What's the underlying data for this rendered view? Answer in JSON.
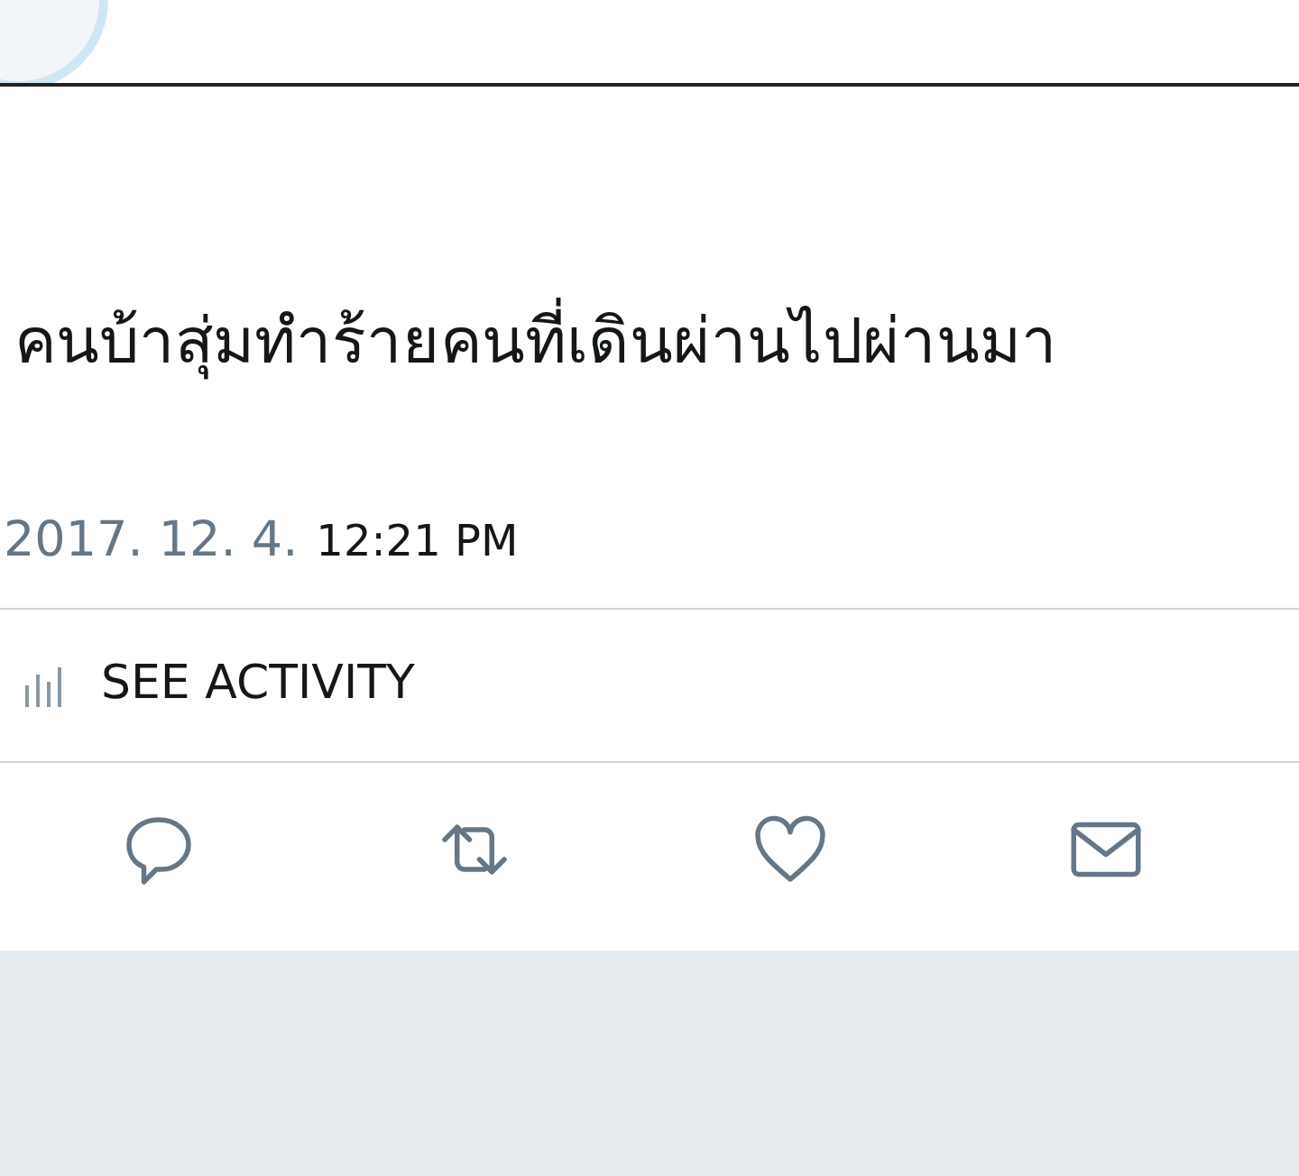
{
  "tweet": {
    "text": "คนบ้าสุ่มทำร้ายคนที่เดินผ่านไปผ่านมา",
    "date": "2017. 12. 4.",
    "time": "12:21 PM"
  },
  "activity": {
    "label": "SEE ACTIVITY"
  },
  "actions": [
    {
      "kind": "reply"
    },
    {
      "kind": "retweet"
    },
    {
      "kind": "like"
    },
    {
      "kind": "message"
    }
  ]
}
